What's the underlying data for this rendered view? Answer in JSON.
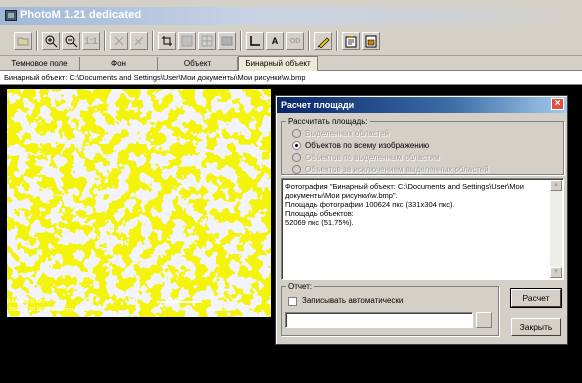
{
  "window": {
    "title": "PhotoM 1.21 dedicated"
  },
  "toolbar": {
    "buttons": [
      {
        "icon": "open-folder-icon",
        "enabled": false
      },
      {
        "icon": "zoom-in-icon",
        "enabled": true
      },
      {
        "icon": "zoom-out-icon",
        "enabled": true
      },
      {
        "label": "1:1",
        "icon": "actual-size-icon",
        "enabled": false
      },
      {
        "icon": "cross-ruler-icon",
        "enabled": false
      },
      {
        "icon": "calibrate-icon",
        "enabled": false
      },
      {
        "icon": "crop-icon",
        "enabled": true
      },
      {
        "icon": "select-area-icon",
        "enabled": false
      },
      {
        "icon": "grid-icon",
        "enabled": false
      },
      {
        "icon": "mask-icon",
        "enabled": false
      },
      {
        "icon": "axis-icon",
        "enabled": true
      },
      {
        "label": "A",
        "icon": "text-icon",
        "enabled": true
      },
      {
        "label": "OD",
        "icon": "density-icon",
        "enabled": false
      },
      {
        "icon": "pencil-icon",
        "enabled": true
      },
      {
        "icon": "clipboard-icon",
        "enabled": true
      },
      {
        "icon": "stamp-icon",
        "enabled": true
      }
    ]
  },
  "tabs": [
    {
      "label": "Темновое поле"
    },
    {
      "label": "Фон"
    },
    {
      "label": "Объект"
    },
    {
      "label": "Бинарный объект",
      "active": true
    }
  ],
  "pathbar": {
    "text": "Бинарный объект: C:\\Documents and Settings\\User\\Мои документы\\Мои рисунки\\w.bmp"
  },
  "image": {
    "colors": {
      "background": "#1a1adc",
      "foreground": "#ffff00"
    },
    "scalebar_text": "10 μm",
    "caption_left_1": "HV    mag    D    WD",
    "caption_left_2": "20.0 kV  10 000 x  10.0 mm  ETD",
    "caption_right": "CV-REST"
  },
  "dialog": {
    "title": "Расчет площади",
    "calc_group_label": "Рассчитать площадь:",
    "options": [
      {
        "label": "Выделенных областей",
        "enabled": false,
        "selected": false
      },
      {
        "label": "Объектов по всему изображению",
        "enabled": true,
        "selected": true
      },
      {
        "label": "Объектов по выделенным областям",
        "enabled": false,
        "selected": false
      },
      {
        "label": "Объектов за исключением выделенных областей",
        "enabled": false,
        "selected": false
      }
    ],
    "results_text": "Фотография \"Бинарный объект: C:\\Documents and Settings\\User\\Мои документы\\Мои рисунки\\w.bmp\".\nПлощадь фотографии 100624 пкс (331x304 пкс).\nПлощадь объектов:\n52069 пкс (51.75%).",
    "report_group_label": "Отчет:",
    "auto_write_label": "Записывать автоматически",
    "auto_write_checked": false,
    "report_path_value": "",
    "calc_button": "Расчет",
    "close_button": "Закрыть"
  }
}
